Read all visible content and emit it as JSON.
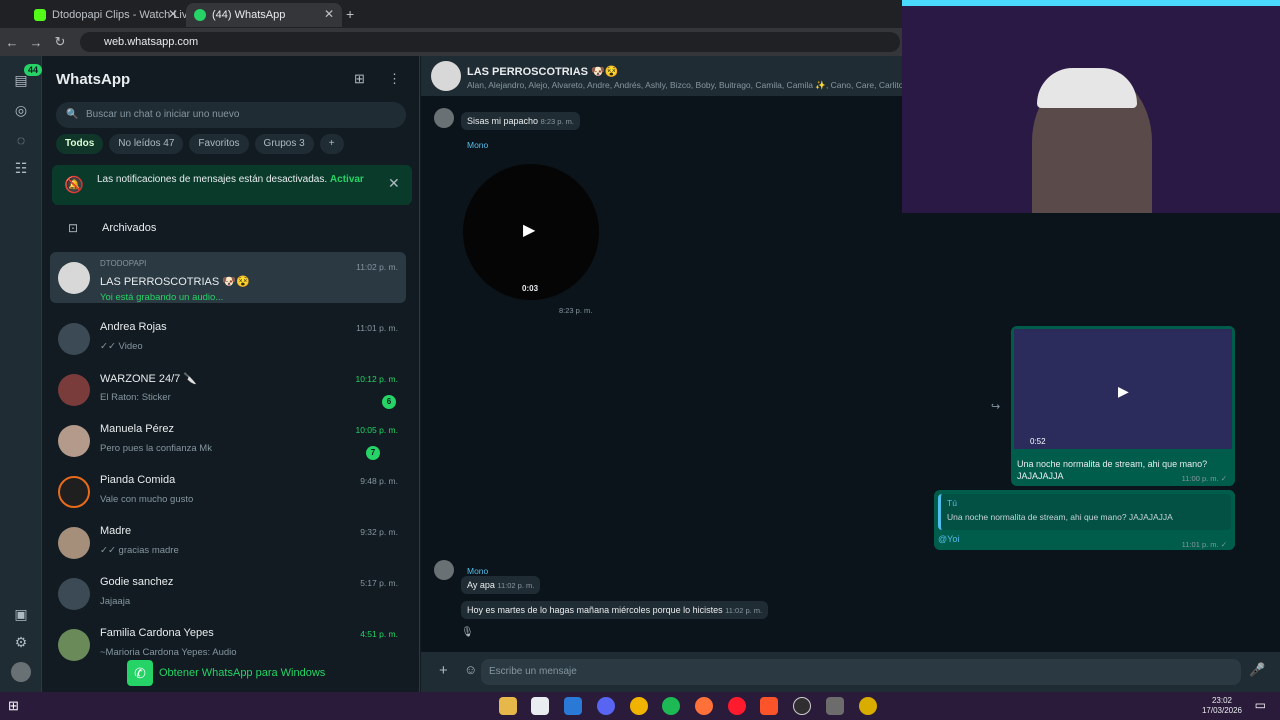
{
  "browser": {
    "tabs": [
      {
        "title": "Dtodopapi Clips - Watch Live o"
      },
      {
        "title": "(44) WhatsApp"
      }
    ],
    "url": "web.whatsapp.com"
  },
  "rail": {
    "badge": "44"
  },
  "sidebar": {
    "title": "WhatsApp",
    "search_placeholder": "Buscar un chat o iniciar uno nuevo",
    "filters": [
      {
        "label": "Todos"
      },
      {
        "label": "No leídos 47"
      },
      {
        "label": "Favoritos"
      },
      {
        "label": "Grupos 3"
      }
    ],
    "notice": {
      "text": "Las notificaciones de mensajes están desactivadas.",
      "action": "Activar"
    },
    "archived_label": "Archivados",
    "chats": [
      {
        "name": "LAS PERROSCOTRIAS 🐶😵",
        "preview": "Yoi está grabando un audio...",
        "time": "11:02 p. m.",
        "top": "DTODOPAPI"
      },
      {
        "name": "Andrea Rojas",
        "preview": "✓✓ Video",
        "time": "11:01 p. m."
      },
      {
        "name": "WARZONE 24/7 🔪",
        "preview": "El Raton: Sticker",
        "time": "10:12 p. m.",
        "unread": "6"
      },
      {
        "name": "Manuela Pérez",
        "preview": "Pero pues la confianza Mk",
        "time": "10:05 p. m.",
        "unread": "7"
      },
      {
        "name": "Pianda Comida",
        "preview": "Vale con mucho gusto",
        "time": "9:48 p. m."
      },
      {
        "name": "Madre",
        "preview": "✓✓ gracias madre",
        "time": "9:32 p. m."
      },
      {
        "name": "Godie sanchez",
        "preview": "Jajaaja",
        "time": "5:17 p. m."
      },
      {
        "name": "Familia Cardona Yepes",
        "preview": "~Marioria Cardona Yepes: Audio",
        "time": "4:51 p. m."
      }
    ],
    "get_app": "Obtener WhatsApp para Windows"
  },
  "chat": {
    "group_name": "LAS PERROSCOTRIAS 🐶😵",
    "members": "Alan, Alejandro, Alejo, Alvareto, Andre, Andrés, Ashly, Bizco, Boby, Buitrago, Camila, Camila ✨, Cano, Care, Carlito",
    "messages": {
      "m1_text": "Sisas mi papacho",
      "m1_time": "8:23 p. m.",
      "m2_sender": "Mono",
      "m2_duration": "0:03",
      "m2_time": "8:23 p. m.",
      "m3_caption": "Una noche normalita de stream, ahi que mano? JAJAJAJJA",
      "m3_time": "11:00 p. m. ✓",
      "m3_video_len": "0:52",
      "m4_sender": "Tú",
      "m4_quote": "Una noche normalita de stream, ahi que mano? JAJAJAJJA",
      "m4_text": "@Yoi",
      "m4_time": "11:01 p. m. ✓",
      "m5_sender": "Mono",
      "m5_text": "Ay apa",
      "m5_time": "11:02 p. m.",
      "m6_text": "Hoy es martes de lo hagas mañana miércoles porque lo hicistes",
      "m6_time": "11:02 p. m."
    },
    "input_placeholder": "Escribe un mensaje"
  },
  "taskbar": {
    "time": "23:02",
    "date": "17/03/2026"
  },
  "colors": {
    "accent": "#25d366",
    "bg": "#111b21",
    "panel": "#202c33",
    "outgoing": "#005c4b"
  }
}
